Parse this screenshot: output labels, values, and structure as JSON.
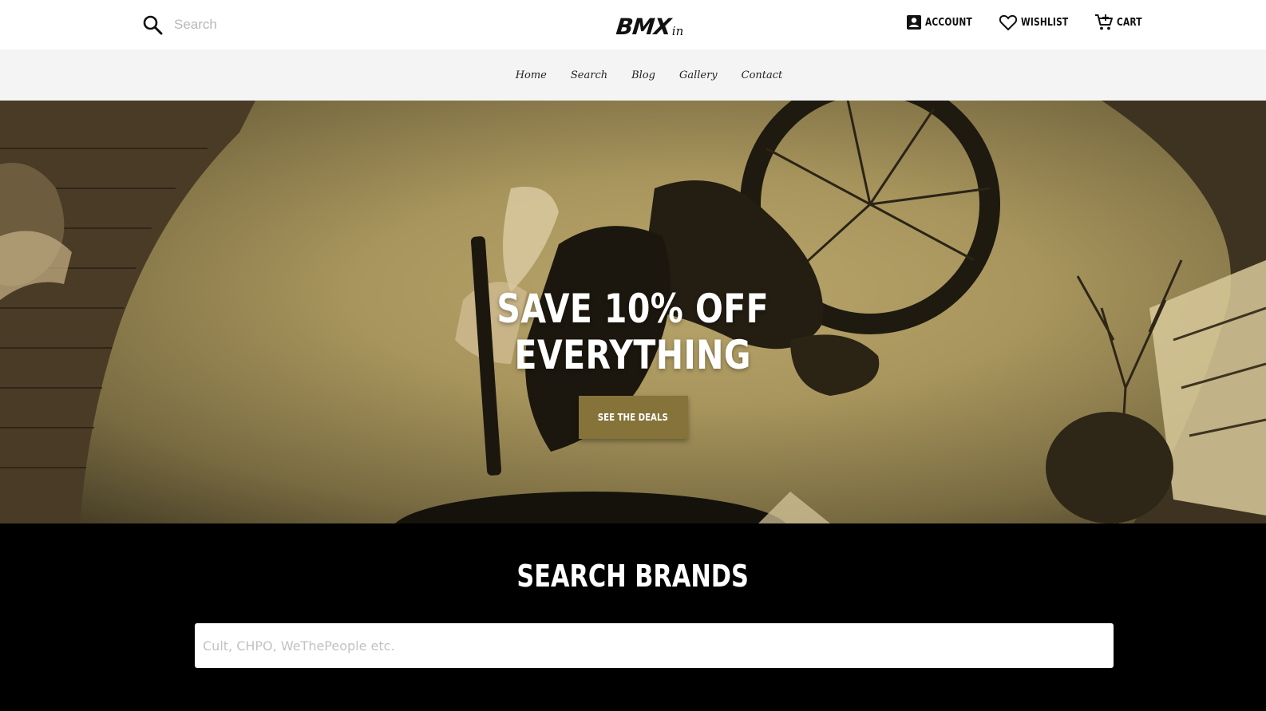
{
  "header": {
    "search_placeholder": "Search",
    "logo_main": "BMX",
    "logo_sub": "in",
    "account_label": "ACCOUNT",
    "wishlist_label": "WISHLIST",
    "cart_label": "CART"
  },
  "nav": {
    "items": [
      "Home",
      "Search",
      "Blog",
      "Gallery",
      "Contact"
    ]
  },
  "hero": {
    "title_line1": "SAVE 10% OFF",
    "title_line2": "EVERYTHING",
    "cta_label": "SEE THE DEALS"
  },
  "brands": {
    "heading": "SEARCH BRANDS",
    "input_placeholder": "Cult, CHPO, WeThePeople etc."
  },
  "colors": {
    "accent": "#85733a",
    "nav_bg": "#f4f4f4",
    "section_bg": "#000000"
  },
  "icons": [
    "search-icon",
    "account-icon",
    "heart-icon",
    "cart-icon"
  ]
}
